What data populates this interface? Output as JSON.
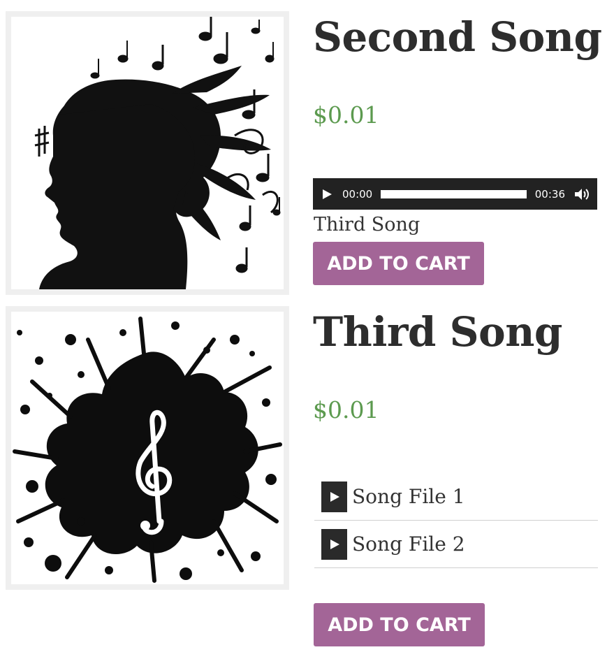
{
  "products": [
    {
      "title": "Second Song",
      "price": "$0.01",
      "image": "woman-silhouette-music-notes",
      "player": {
        "current_time": "00:00",
        "duration": "00:36",
        "progress": 0
      },
      "track_name": "Third Song",
      "cart_label": "ADD TO CART"
    },
    {
      "title": "Third Song",
      "price": "$0.01",
      "image": "ink-splash-treble-clef",
      "playlist": [
        {
          "label": "Song File 1",
          "icon": "play-icon"
        },
        {
          "label": "Song File 2",
          "icon": "play-icon"
        }
      ],
      "cart_label": "ADD TO CART"
    }
  ],
  "colors": {
    "accent_button": "#a36597",
    "price": "#5c9a4f",
    "player_bg": "#222222",
    "frame_bg": "#efefef"
  }
}
